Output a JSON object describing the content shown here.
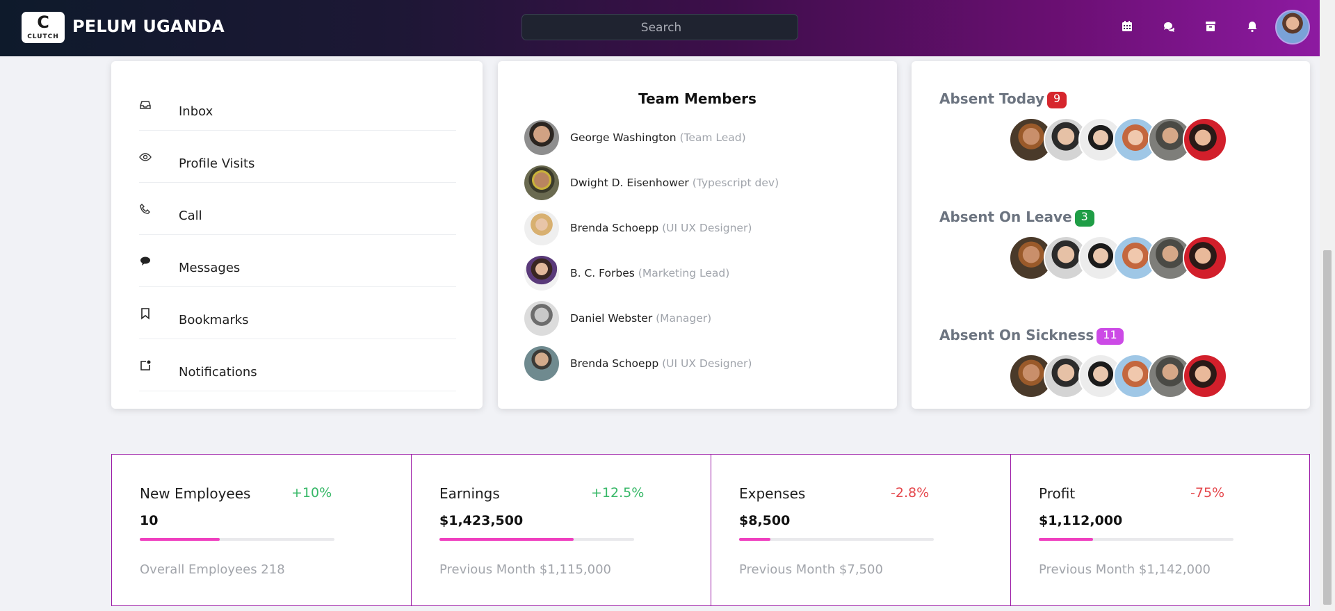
{
  "header": {
    "logo_text": "CLUTCH",
    "brand": "PELUM UGANDA",
    "search_placeholder": "Search",
    "icons": [
      "calendar-icon",
      "chat-icon",
      "archive-icon",
      "bell-icon"
    ]
  },
  "menu": {
    "items": [
      {
        "label": "Inbox",
        "icon": "inbox-icon"
      },
      {
        "label": "Profile Visits",
        "icon": "eye-icon"
      },
      {
        "label": "Call",
        "icon": "phone-icon"
      },
      {
        "label": "Messages",
        "icon": "message-icon"
      },
      {
        "label": "Bookmarks",
        "icon": "bookmark-icon"
      },
      {
        "label": "Notifications",
        "icon": "notification-icon"
      }
    ]
  },
  "team": {
    "title": "Team Members",
    "members": [
      {
        "name": "George Washington",
        "role": "(Team Lead)"
      },
      {
        "name": "Dwight D. Eisenhower",
        "role": "(Typescript dev)"
      },
      {
        "name": "Brenda Schoepp",
        "role": "(UI UX Designer)"
      },
      {
        "name": "B. C. Forbes",
        "role": "(Marketing Lead)"
      },
      {
        "name": "Daniel Webster",
        "role": "(Manager)"
      },
      {
        "name": "Brenda Schoepp",
        "role": "(UI UX Designer)"
      }
    ]
  },
  "absence": {
    "groups": [
      {
        "title": "Absent Today",
        "count": "9",
        "color": "#d6262d"
      },
      {
        "title": "Absent On Leave",
        "count": "3",
        "color": "#1f9d46"
      },
      {
        "title": "Absent On Sickness",
        "count": "11",
        "color": "#cc4ae6"
      }
    ]
  },
  "stats": [
    {
      "title": "New Employees",
      "change": "+10%",
      "trend": "up",
      "value": "10",
      "progress": 0.41,
      "sub": "Overall Employees 218"
    },
    {
      "title": "Earnings",
      "change": "+12.5%",
      "trend": "up",
      "value": "$1,423,500",
      "progress": 0.69,
      "sub": "Previous Month $1,115,000"
    },
    {
      "title": "Expenses",
      "change": "-2.8%",
      "trend": "down",
      "value": "$8,500",
      "progress": 0.16,
      "sub": "Previous Month $7,500"
    },
    {
      "title": "Profit",
      "change": "-75%",
      "trend": "down",
      "value": "$1,112,000",
      "progress": 0.28,
      "sub": "Previous Month $1,142,000"
    }
  ]
}
